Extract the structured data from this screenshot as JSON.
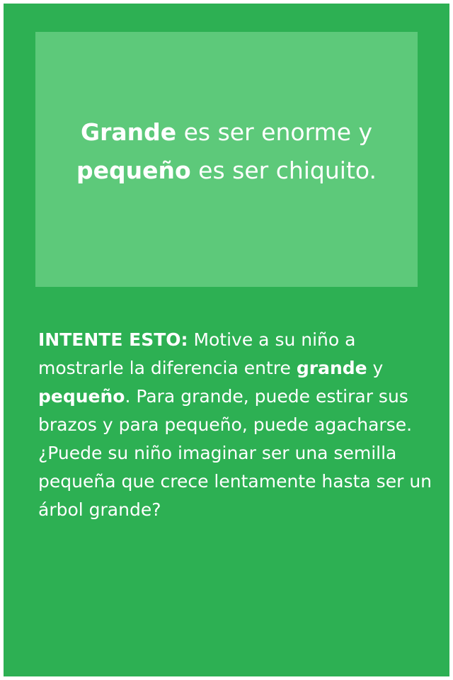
{
  "headline": {
    "word1": "Grande",
    "text1": " es ser enorme y",
    "word2": "pequeño",
    "text2": " es ser chiquito."
  },
  "tip": {
    "lead": "INTENTE ESTO:",
    "text1": " Motive a su niño a mostrarle la diferencia entre ",
    "bold1": "grande",
    "text2": " y ",
    "bold2": "pequeño",
    "text3": ". Para grande, puede estirar sus brazos y para pequeño, puede agacharse. ¿Puede su niño imaginar ser una semilla pequeña que crece lentamente hasta ser un árbol grande?"
  },
  "colors": {
    "background": "#2db053",
    "panel": "#5dc97a",
    "text": "#ffffff"
  }
}
